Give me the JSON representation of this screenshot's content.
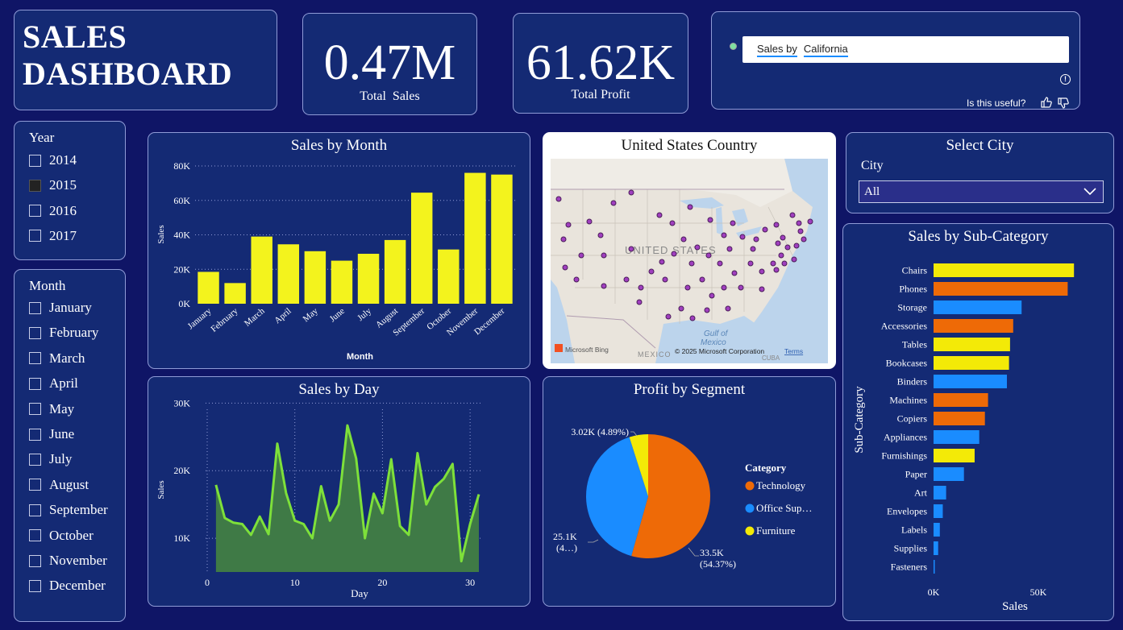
{
  "title": {
    "line1": "SALES",
    "line2": "DASHBOARD"
  },
  "kpis": {
    "total_sales": {
      "value": "0.47M",
      "label": "Total  Sales"
    },
    "total_profit": {
      "value": "61.62K",
      "label": "Total Profit"
    }
  },
  "qa": {
    "prefix": "Sales by",
    "term": "California",
    "useful": "Is this useful?",
    "info_icon": "info-icon"
  },
  "year_slicer": {
    "title": "Year",
    "items": [
      {
        "label": "2014",
        "checked": false
      },
      {
        "label": "2015",
        "checked": true
      },
      {
        "label": "2016",
        "checked": false
      },
      {
        "label": "2017",
        "checked": false
      }
    ]
  },
  "month_slicer": {
    "title": "Month",
    "items": [
      {
        "label": "January"
      },
      {
        "label": "February"
      },
      {
        "label": "March"
      },
      {
        "label": "April"
      },
      {
        "label": "May"
      },
      {
        "label": "June"
      },
      {
        "label": "July"
      },
      {
        "label": "August"
      },
      {
        "label": "September"
      },
      {
        "label": "October"
      },
      {
        "label": "November"
      },
      {
        "label": "December"
      }
    ]
  },
  "map": {
    "title": "United States Country",
    "country_label": "UNITED STATES",
    "gulf_label": "Gulf of Mexico",
    "mexico_label": "MEXICO",
    "cuba_label": "CUBA",
    "bing_label": "Microsoft Bing",
    "copyright": "© 2025 Microsoft Corporation",
    "terms": "Terms"
  },
  "city_slicer": {
    "title": "Select City",
    "label": "City",
    "selected": "All"
  },
  "colors": {
    "bar_yellow": "#f3f31d",
    "line_green": "#7ee03a",
    "area_green": "#3f7a46",
    "tech": "#ee6a07",
    "office": "#1a8cff",
    "furniture": "#f3ea07",
    "bg": "#0f1566",
    "card": "#142a74"
  },
  "chart_data": [
    {
      "id": "sales_by_month",
      "type": "bar",
      "title": "Sales by Month",
      "xlabel": "Month",
      "ylabel": "Sales",
      "ylim": [
        0,
        80000
      ],
      "yticks": [
        "0K",
        "20K",
        "40K",
        "60K",
        "80K"
      ],
      "categories": [
        "January",
        "February",
        "March",
        "April",
        "May",
        "June",
        "July",
        "August",
        "September",
        "October",
        "November",
        "December"
      ],
      "values": [
        18500,
        12000,
        39000,
        34500,
        30500,
        25000,
        29000,
        37000,
        64500,
        31500,
        76000,
        75000
      ],
      "grid": true
    },
    {
      "id": "sales_by_day",
      "type": "area",
      "title": "Sales by Day",
      "xlabel": "Day",
      "ylabel": "Sales",
      "xlim": [
        0,
        32
      ],
      "ylim": [
        5000,
        31000
      ],
      "xticks": [
        "0",
        "10",
        "20",
        "30"
      ],
      "yticks": [
        "10K",
        "20K",
        "30K"
      ],
      "x": [
        1,
        2,
        3,
        4,
        5,
        6,
        7,
        8,
        9,
        10,
        11,
        12,
        13,
        14,
        15,
        16,
        17,
        18,
        19,
        20,
        21,
        22,
        23,
        24,
        25,
        26,
        27,
        28,
        29,
        30,
        31
      ],
      "values": [
        17900,
        13000,
        12300,
        12100,
        10500,
        13200,
        10600,
        24000,
        16700,
        12600,
        12100,
        10000,
        17700,
        12600,
        15000,
        26700,
        21800,
        10000,
        16600,
        13700,
        21700,
        11800,
        10500,
        22600,
        15000,
        17600,
        18800,
        21000,
        6600,
        12100,
        16500
      ],
      "grid": true
    },
    {
      "id": "profit_by_segment",
      "type": "pie",
      "title": "Profit by Segment",
      "legend_title": "Category",
      "legend_position": "right",
      "slices": [
        {
          "name": "Technology",
          "legend": "Technology",
          "value": 33.5,
          "label": "33.5K",
          "pct": "(54.37%)"
        },
        {
          "name": "Office Supplies",
          "legend": "Office Sup…",
          "value": 25.1,
          "label": "25.1K",
          "pct": "(4…)"
        },
        {
          "name": "Furniture",
          "legend": "Furniture",
          "value": 3.02,
          "label": "3.02K (4.89%)",
          "pct": ""
        }
      ]
    },
    {
      "id": "sales_by_subcategory",
      "type": "bar",
      "orientation": "horizontal",
      "title": "Sales by Sub-Category",
      "xlabel": "Sales",
      "ylabel": "Sub-Category",
      "xlim": [
        0,
        75000
      ],
      "xticks": [
        "0K",
        "50K"
      ],
      "categories": [
        "Chairs",
        "Phones",
        "Storage",
        "Accessories",
        "Tables",
        "Bookcases",
        "Binders",
        "Machines",
        "Copiers",
        "Appliances",
        "Furnishings",
        "Paper",
        "Art",
        "Envelopes",
        "Labels",
        "Supplies",
        "Fasteners"
      ],
      "values": [
        67000,
        64000,
        42000,
        38000,
        36500,
        36000,
        35000,
        26000,
        24500,
        21800,
        19600,
        14500,
        6000,
        4400,
        3000,
        2200,
        500
      ],
      "color_groups": [
        "furniture",
        "technology",
        "office",
        "technology",
        "furniture",
        "furniture",
        "office",
        "technology",
        "technology",
        "office",
        "furniture",
        "office",
        "office",
        "office",
        "office",
        "office",
        "office"
      ]
    }
  ]
}
